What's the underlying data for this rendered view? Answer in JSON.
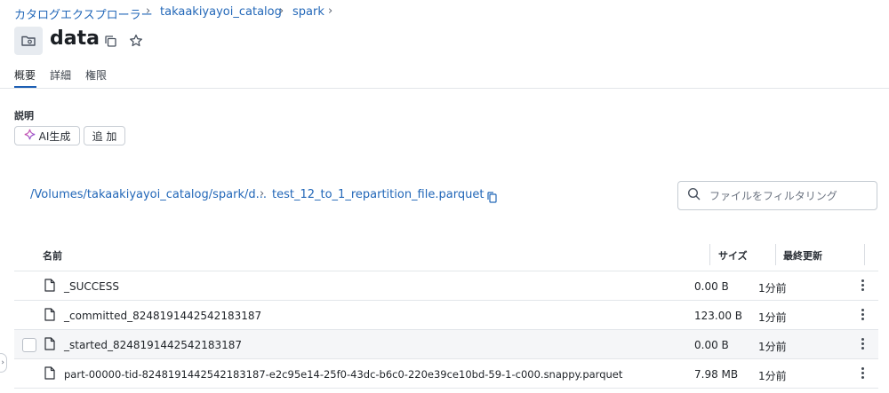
{
  "breadcrumb": {
    "items": [
      "カタログエクスプローラー",
      "takaakiyayoi_catalog",
      "spark"
    ],
    "separator": "›"
  },
  "page": {
    "title": "data"
  },
  "tabs": [
    {
      "label": "概要",
      "active": true
    },
    {
      "label": "詳細",
      "active": false
    },
    {
      "label": "権限",
      "active": false
    }
  ],
  "description": {
    "label": "説明",
    "ai_button": "AI生成",
    "add_button": "追 加"
  },
  "path": {
    "prefix": "/Volumes/takaakiyayoi_catalog/spark/d...",
    "separator": "›",
    "current": "test_12_to_1_repartition_file.parquet"
  },
  "search": {
    "placeholder": "ファイルをフィルタリング"
  },
  "table": {
    "columns": {
      "name": "名前",
      "size": "サイズ",
      "modified": "最終更新"
    },
    "rows": [
      {
        "name": "_SUCCESS",
        "size": "0.00 B",
        "modified": "1分前"
      },
      {
        "name": "_committed_8248191442542183187",
        "size": "123.00 B",
        "modified": "1分前"
      },
      {
        "name": "_started_8248191442542183187",
        "size": "0.00 B",
        "modified": "1分前"
      },
      {
        "name": "part-00000-tid-8248191442542183187-e2c95e14-25f0-43dc-b6c0-220e39ce10bd-59-1-c000.snappy.parquet",
        "size": "7.98 MB",
        "modified": "1分前"
      }
    ]
  },
  "colors": {
    "link": "#2267b8",
    "accent": "#1d5fb4"
  }
}
